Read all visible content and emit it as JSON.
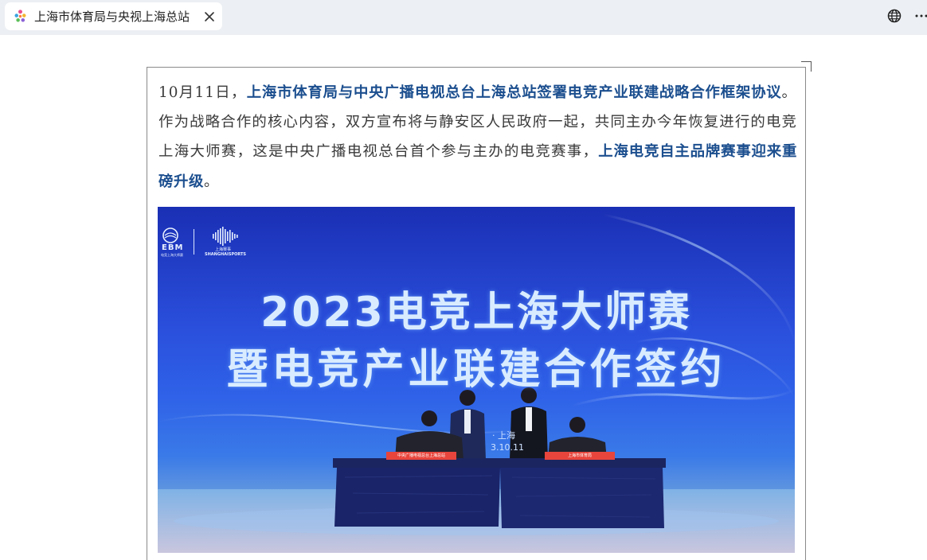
{
  "browser": {
    "tab_title": "上海市体育局与央视上海总站",
    "icons": [
      "site-favicon",
      "close-icon",
      "globe-icon",
      "more-icon"
    ]
  },
  "article": {
    "p_date": "10月11日，",
    "p_bold1": "上海市体育局与中央广播电视总台上海总站签署电竞产业联建战略合作框架协议",
    "p_mid": "。作为战略合作的核心内容，双方宣布将与静安区人民政府一起，共同主办今年恢复进行的电竞上海大师赛，这是中央广播电视总台首个参与主办的电竞赛事，",
    "p_bold2": "上海电竞自主品牌赛事迎来重磅升级",
    "p_end": "。"
  },
  "photo": {
    "logo_ebm": "EBM",
    "logo_ebm_sub": "电竞上海大师赛",
    "logo_sports_cn": "上海赛事",
    "logo_sports_en": "SHANGHAISPORTS",
    "headline_line1": "2023电竞上海大师赛",
    "headline_line2": "暨电竞产业联建合作签约",
    "screen_text1": "· 上海",
    "screen_text2": "3.10.11",
    "sign_left": "中央广播电视总台上海总站",
    "sign_right": "上海市体育局"
  },
  "colors": {
    "link_blue": "#1c4f8f",
    "body_text": "#3b3b3b",
    "stage_blue": "#2f62e8",
    "sign_red": "#e8453c"
  }
}
